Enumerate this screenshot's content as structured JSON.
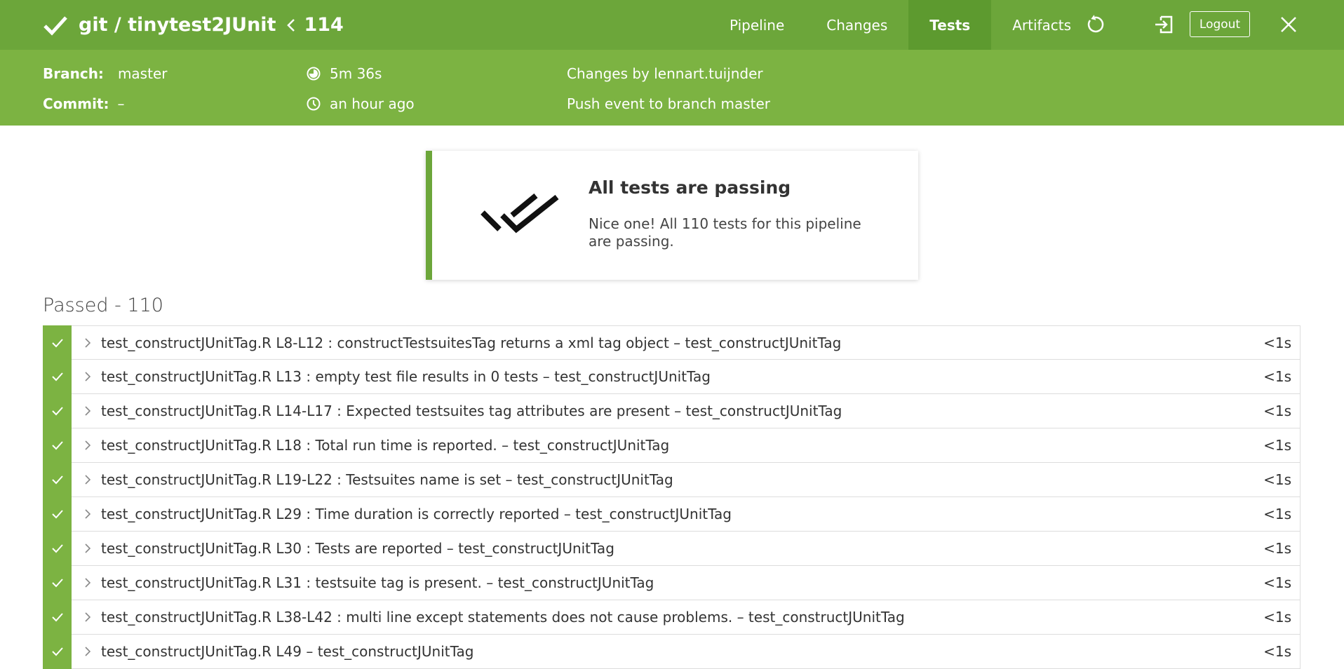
{
  "header": {
    "repo": "git / tinytest2JUnit",
    "build_number": "114",
    "tabs": [
      {
        "label": "Pipeline"
      },
      {
        "label": "Changes"
      },
      {
        "label": "Tests"
      },
      {
        "label": "Artifacts"
      }
    ],
    "active_tab": "Tests",
    "logout_label": "Logout",
    "icons": [
      "checkmark-icon",
      "chevron-left-icon",
      "rerun-icon",
      "open-classic-icon",
      "close-icon"
    ]
  },
  "subheader": {
    "branch_label": "Branch:",
    "branch_value": "master",
    "commit_label": "Commit:",
    "commit_value": "–",
    "duration": "5m 36s",
    "time_ago": "an hour ago",
    "changes": "Changes by lennart.tuijnder",
    "event": "Push event to branch master"
  },
  "banner": {
    "title": "All tests are passing",
    "text": "Nice one! All 110 tests for this pipeline are passing."
  },
  "section_title": "Passed - 110",
  "tests": [
    {
      "name": "test_constructJUnitTag.R L8-L12 : constructTestsuitesTag returns a xml tag object – test_constructJUnitTag",
      "time": "<1s"
    },
    {
      "name": "test_constructJUnitTag.R L13 : empty test file results in 0 tests – test_constructJUnitTag",
      "time": "<1s"
    },
    {
      "name": "test_constructJUnitTag.R L14-L17 : Expected testsuites tag attributes are present – test_constructJUnitTag",
      "time": "<1s"
    },
    {
      "name": "test_constructJUnitTag.R L18 : Total run time is reported. – test_constructJUnitTag",
      "time": "<1s"
    },
    {
      "name": "test_constructJUnitTag.R L19-L22 : Testsuites name is set – test_constructJUnitTag",
      "time": "<1s"
    },
    {
      "name": "test_constructJUnitTag.R L29 : Time duration is correctly reported – test_constructJUnitTag",
      "time": "<1s"
    },
    {
      "name": "test_constructJUnitTag.R L30 : Tests are reported – test_constructJUnitTag",
      "time": "<1s"
    },
    {
      "name": "test_constructJUnitTag.R L31 : testsuite tag is present. – test_constructJUnitTag",
      "time": "<1s"
    },
    {
      "name": "test_constructJUnitTag.R L38-L42 : multi line except statements does not cause problems. – test_constructJUnitTag",
      "time": "<1s"
    },
    {
      "name": "test_constructJUnitTag.R L49 – test_constructJUnitTag",
      "time": "<1s"
    }
  ],
  "colors": {
    "topbar": "#6ca63a",
    "subbar": "#7cb342",
    "active_tab": "#5d9a2f",
    "status_pass": "#7cb342"
  }
}
